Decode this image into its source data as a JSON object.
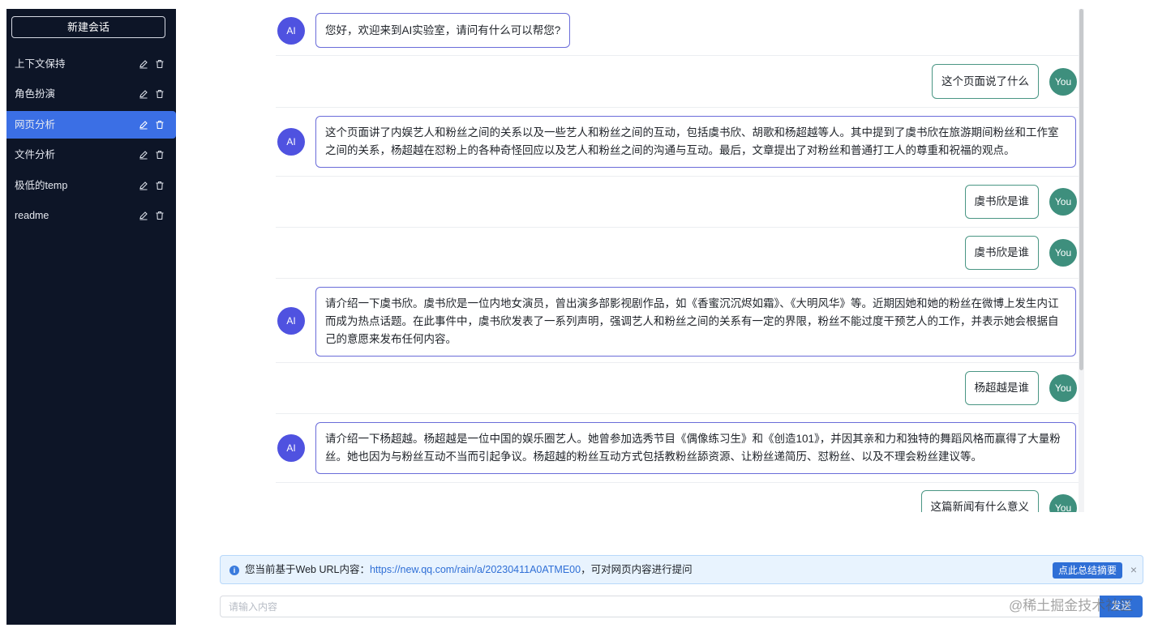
{
  "sidebar": {
    "new_chat_label": "新建会话",
    "sessions": [
      {
        "label": "上下文保持",
        "active": false
      },
      {
        "label": "角色扮演",
        "active": false
      },
      {
        "label": "网页分析",
        "active": true
      },
      {
        "label": "文件分析",
        "active": false
      },
      {
        "label": "极低的temp",
        "active": false
      },
      {
        "label": "readme",
        "active": false
      }
    ],
    "item_icons": [
      "edit-icon",
      "trash-icon"
    ]
  },
  "chat": {
    "ai_avatar_label": "AI",
    "user_avatar_label": "You",
    "messages": [
      {
        "role": "ai",
        "text": "您好，欢迎来到AI实验室，请问有什么可以帮您?"
      },
      {
        "role": "user",
        "text": "这个页面说了什么"
      },
      {
        "role": "ai",
        "text": "这个页面讲了内娱艺人和粉丝之间的关系以及一些艺人和粉丝之间的互动，包括虞书欣、胡歌和杨超越等人。其中提到了虞书欣在旅游期间粉丝和工作室之间的关系，杨超越在怼粉上的各种奇怪回应以及艺人和粉丝之间的沟通与互动。最后，文章提出了对粉丝和普通打工人的尊重和祝福的观点。"
      },
      {
        "role": "user",
        "text": "虞书欣是谁"
      },
      {
        "role": "user",
        "text": "虞书欣是谁"
      },
      {
        "role": "ai",
        "text": "请介绍一下虞书欣。虞书欣是一位内地女演员，曾出演多部影视剧作品，如《香蜜沉沉烬如霜》、《大明风华》等。近期因她和她的粉丝在微博上发生内讧而成为热点话题。在此事件中，虞书欣发表了一系列声明，强调艺人和粉丝之间的关系有一定的界限，粉丝不能过度干预艺人的工作，并表示她会根据自己的意愿来发布任何内容。"
      },
      {
        "role": "user",
        "text": "杨超越是谁"
      },
      {
        "role": "ai",
        "text": "请介绍一下杨超越。杨超越是一位中国的娱乐圈艺人。她曾参加选秀节目《偶像练习生》和《创造101》，并因其亲和力和独特的舞蹈风格而赢得了大量粉丝。她也因为与粉丝互动不当而引起争议。杨超越的粉丝互动方式包括教粉丝舔资源、让粉丝递简历、怼粉丝、以及不理会粉丝建议等。"
      },
      {
        "role": "user",
        "text": "这篇新闻有什么意义"
      }
    ]
  },
  "notice": {
    "icon": "info-icon",
    "prefix": "您当前基于Web URL内容：",
    "url": "https://new.qq.com/rain/a/20230411A0ATME00",
    "suffix": "，可对网页内容进行提问",
    "summary_button": "点此总结摘要",
    "close_symbol": "×"
  },
  "input": {
    "placeholder": "请输入内容",
    "send_label": "发送"
  },
  "watermark": "@稀土掘金技术社区",
  "colors": {
    "sidebar_bg": "#0d1527",
    "active_item": "#3b6fe5",
    "ai_avatar": "#4f52e0",
    "user_avatar": "#3e8f7d",
    "primary": "#2f6fd6"
  }
}
